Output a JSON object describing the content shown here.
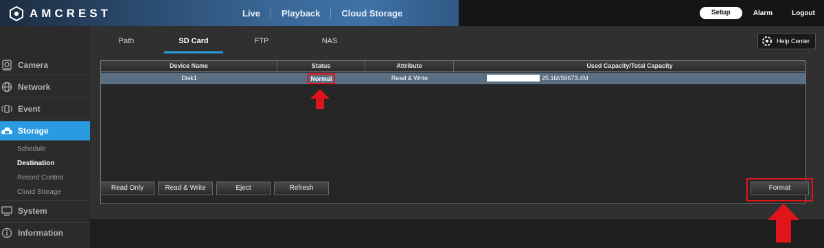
{
  "app": {
    "brand": "AMCREST",
    "accent_color": "#2a9be0",
    "highlight_color": "#e0151b"
  },
  "topnav": {
    "items": [
      "Live",
      "Playback",
      "Cloud Storage"
    ],
    "setup_label": "Setup",
    "alarm_label": "Alarm",
    "logout_label": "Logout"
  },
  "sidebar": {
    "items": [
      {
        "label": "Camera",
        "icon": "camera-icon"
      },
      {
        "label": "Network",
        "icon": "network-globe-icon"
      },
      {
        "label": "Event",
        "icon": "event-alarm-icon"
      },
      {
        "label": "Storage",
        "icon": "cloud-storage-icon"
      },
      {
        "label": "System",
        "icon": "monitor-icon"
      },
      {
        "label": "Information",
        "icon": "info-icon"
      }
    ],
    "storage_subitems": [
      "Schedule",
      "Destination",
      "Record Control",
      "Cloud Storage"
    ],
    "active_item": "Storage",
    "active_subitem": "Destination"
  },
  "tabs": {
    "items": [
      "Path",
      "SD Card",
      "FTP",
      "NAS"
    ],
    "active": "SD Card"
  },
  "help": {
    "label": "Help Center"
  },
  "table": {
    "headers": [
      "Device Name",
      "Status",
      "Attribute",
      "Used Capacity/Total Capacity"
    ],
    "rows": [
      {
        "device_name": "Disk1",
        "status": "Normal",
        "attribute": "Read & Write",
        "capacity": "25.1M/59673.4M"
      }
    ]
  },
  "actions": {
    "read_only": "Read Only",
    "read_write": "Read & Write",
    "eject": "Eject",
    "refresh": "Refresh",
    "format": "Format"
  }
}
